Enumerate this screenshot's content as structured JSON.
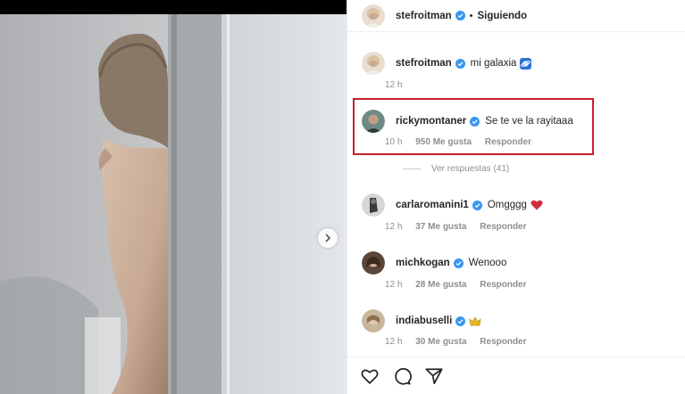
{
  "post": {
    "author": "stefroitman",
    "follow_status": "Siguiendo",
    "separator": "•"
  },
  "comments": [
    {
      "username": "stefroitman",
      "text": "mi galaxia",
      "emoji": "planet-emoji",
      "time": "12 h"
    },
    {
      "username": "rickymontaner",
      "text": "Se te ve la rayitaaa",
      "time": "10 h",
      "likes": "950 Me gusta",
      "reply": "Responder"
    },
    {
      "username": "carlaromanini1",
      "text": "Omgggg",
      "emoji": "heart-emoji",
      "time": "12 h",
      "likes": "37 Me gusta",
      "reply": "Responder"
    },
    {
      "username": "michkogan",
      "text": "Wenooo",
      "time": "12 h",
      "likes": "28 Me gusta",
      "reply": "Responder"
    },
    {
      "username": "indiabuselli",
      "text": "",
      "emoji": "crown-emoji",
      "time": "12 h",
      "likes": "30 Me gusta",
      "reply": "Responder"
    }
  ],
  "view_replies": "Ver respuestas (41)",
  "colors": {
    "highlight_box": "#c8202b",
    "verified": "#3897f0",
    "meta_text": "#8e8e8e",
    "heart": "#e0245e"
  },
  "icons": {
    "like": "heart-outline-icon",
    "comment": "comment-bubble-icon",
    "share": "paper-plane-icon",
    "next": "chevron-right-icon"
  }
}
